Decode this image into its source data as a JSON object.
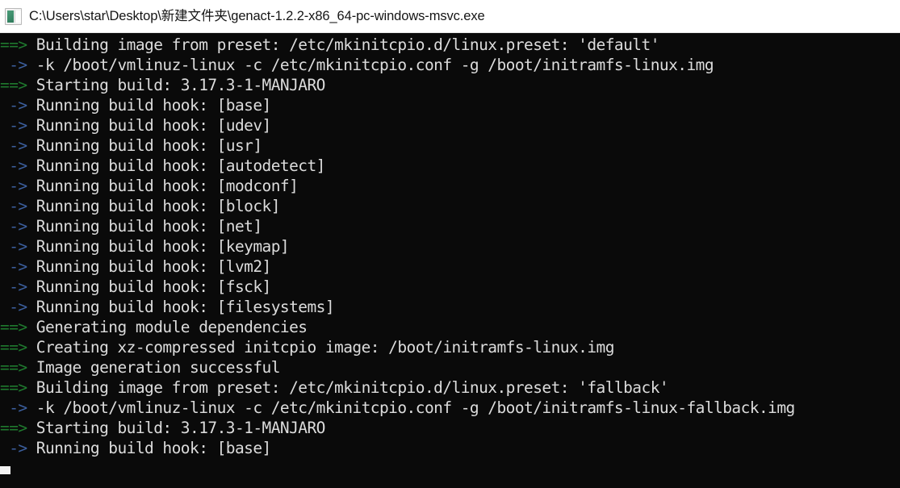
{
  "window": {
    "title": "C:\\Users\\star\\Desktop\\新建文件夹\\genact-1.2.2-x86_64-pc-windows-msvc.exe",
    "icon": "console-window-icon",
    "titlebar_background": "#ffffff",
    "titlebar_text_color": "#151515"
  },
  "terminal": {
    "background": "#0a0a0a",
    "foreground": "#dcdcdc",
    "major_arrow_color": "#1f7a2e",
    "minor_arrow_color": "#3c5f9e",
    "cursor_color": "#f2f2f2",
    "major_sigil": "==>",
    "minor_sigil": " ->",
    "lines": [
      {
        "sigil": "==>",
        "kind": "major",
        "text": " Building image from preset: /etc/mkinitcpio.d/linux.preset: 'default'"
      },
      {
        "sigil": " ->",
        "kind": "minor",
        "text": " -k /boot/vmlinuz-linux -c /etc/mkinitcpio.conf -g /boot/initramfs-linux.img"
      },
      {
        "sigil": "==>",
        "kind": "major",
        "text": " Starting build: 3.17.3-1-MANJARO"
      },
      {
        "sigil": " ->",
        "kind": "minor",
        "text": " Running build hook: [base]"
      },
      {
        "sigil": " ->",
        "kind": "minor",
        "text": " Running build hook: [udev]"
      },
      {
        "sigil": " ->",
        "kind": "minor",
        "text": " Running build hook: [usr]"
      },
      {
        "sigil": " ->",
        "kind": "minor",
        "text": " Running build hook: [autodetect]"
      },
      {
        "sigil": " ->",
        "kind": "minor",
        "text": " Running build hook: [modconf]"
      },
      {
        "sigil": " ->",
        "kind": "minor",
        "text": " Running build hook: [block]"
      },
      {
        "sigil": " ->",
        "kind": "minor",
        "text": " Running build hook: [net]"
      },
      {
        "sigil": " ->",
        "kind": "minor",
        "text": " Running build hook: [keymap]"
      },
      {
        "sigil": " ->",
        "kind": "minor",
        "text": " Running build hook: [lvm2]"
      },
      {
        "sigil": " ->",
        "kind": "minor",
        "text": " Running build hook: [fsck]"
      },
      {
        "sigil": " ->",
        "kind": "minor",
        "text": " Running build hook: [filesystems]"
      },
      {
        "sigil": "==>",
        "kind": "major",
        "text": " Generating module dependencies"
      },
      {
        "sigil": "==>",
        "kind": "major",
        "text": " Creating xz-compressed initcpio image: /boot/initramfs-linux.img"
      },
      {
        "sigil": "==>",
        "kind": "major",
        "text": " Image generation successful"
      },
      {
        "sigil": "==>",
        "kind": "major",
        "text": " Building image from preset: /etc/mkinitcpio.d/linux.preset: 'fallback'"
      },
      {
        "sigil": " ->",
        "kind": "minor",
        "text": " -k /boot/vmlinuz-linux -c /etc/mkinitcpio.conf -g /boot/initramfs-linux-fallback.img"
      },
      {
        "sigil": "==>",
        "kind": "major",
        "text": " Starting build: 3.17.3-1-MANJARO"
      },
      {
        "sigil": " ->",
        "kind": "minor",
        "text": " Running build hook: [base]"
      }
    ]
  }
}
